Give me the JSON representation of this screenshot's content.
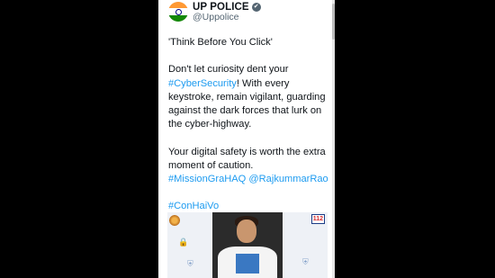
{
  "account": {
    "name": "UP POLICE",
    "handle": "@Uppolice",
    "verified_glyph": "✔"
  },
  "tweet": {
    "p1": "'Think Before You Click'",
    "p2_before": "Don't let curiosity dent your",
    "p2_tag": "#CyberSecurity",
    "p2_after": "! With every keystroke, remain vigilant, guarding against the dark forces that lurk on the cyber-highway.",
    "p3_before": "Your digital safety is worth the extra moment of caution.",
    "p3_tag1": "#MissionGraHAQ",
    "p3_mention": "@RajkummarRao",
    "p4_tag": "#ConHaiVo"
  },
  "media": {
    "badge": "112"
  },
  "colors": {
    "link": "#1d9bf0",
    "text": "#0f1419",
    "muted": "#536471",
    "background": "#000000"
  },
  "icons": [
    "verified-badge-icon",
    "up-police-logo-icon",
    "lock-icon",
    "shield-icon"
  ]
}
